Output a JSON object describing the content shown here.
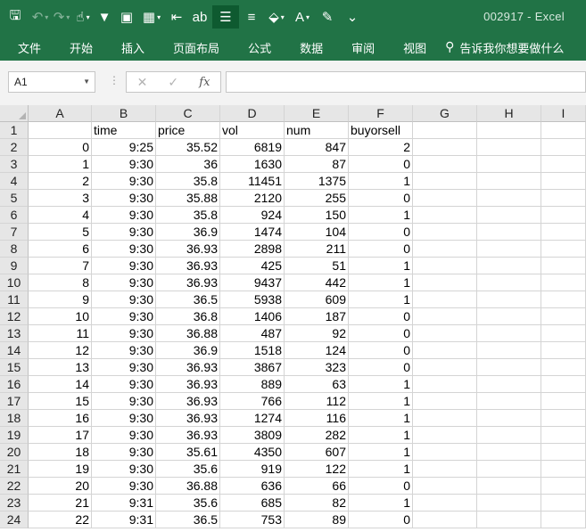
{
  "window": {
    "title": "002917  -  Excel"
  },
  "qat": [
    {
      "name": "save-icon",
      "glyph": "🖫",
      "dim": false,
      "caret": false
    },
    {
      "name": "undo-icon",
      "glyph": "↶",
      "dim": true,
      "caret": true
    },
    {
      "name": "redo-icon",
      "glyph": "↷",
      "dim": true,
      "caret": true
    },
    {
      "name": "touch-mode-icon",
      "glyph": "☝",
      "dim": false,
      "caret": true
    },
    {
      "name": "filter-icon",
      "glyph": "▼",
      "dim": false,
      "caret": false
    },
    {
      "name": "form-icon",
      "glyph": "▣",
      "dim": false,
      "caret": false
    },
    {
      "name": "table-format-icon",
      "glyph": "▦",
      "dim": false,
      "caret": true
    },
    {
      "name": "indent-icon",
      "glyph": "⇤",
      "dim": false,
      "caret": false
    },
    {
      "name": "wrap-text-icon",
      "glyph": "ab",
      "dim": false,
      "caret": false
    },
    {
      "name": "align-middle-icon",
      "glyph": "☰",
      "dim": false,
      "caret": false,
      "active": true
    },
    {
      "name": "align-center-icon",
      "glyph": "≡",
      "dim": false,
      "caret": false
    },
    {
      "name": "fill-color-icon",
      "glyph": "⬙",
      "dim": false,
      "caret": true
    },
    {
      "name": "font-color-icon",
      "glyph": "A",
      "dim": false,
      "caret": true
    },
    {
      "name": "format-painter-icon",
      "glyph": "✎",
      "dim": false,
      "caret": false
    },
    {
      "name": "customize-qat-icon",
      "glyph": "⌄",
      "dim": false,
      "caret": false
    }
  ],
  "menu": [
    "文件",
    "开始",
    "插入",
    "页面布局",
    "公式",
    "数据",
    "审阅",
    "视图"
  ],
  "tell_me": "告诉我你想要做什么",
  "formula_bar": {
    "name_box": "A1",
    "formula": ""
  },
  "columns": [
    "A",
    "B",
    "C",
    "D",
    "E",
    "F",
    "G",
    "H",
    "I"
  ],
  "header_row": [
    "",
    "time",
    "price",
    "vol",
    "num",
    "buyorsell"
  ],
  "rows": [
    [
      "0",
      "9:25",
      "35.52",
      "6819",
      "847",
      "2"
    ],
    [
      "1",
      "9:30",
      "36",
      "1630",
      "87",
      "0"
    ],
    [
      "2",
      "9:30",
      "35.8",
      "11451",
      "1375",
      "1"
    ],
    [
      "3",
      "9:30",
      "35.88",
      "2120",
      "255",
      "0"
    ],
    [
      "4",
      "9:30",
      "35.8",
      "924",
      "150",
      "1"
    ],
    [
      "5",
      "9:30",
      "36.9",
      "1474",
      "104",
      "0"
    ],
    [
      "6",
      "9:30",
      "36.93",
      "2898",
      "211",
      "0"
    ],
    [
      "7",
      "9:30",
      "36.93",
      "425",
      "51",
      "1"
    ],
    [
      "8",
      "9:30",
      "36.93",
      "9437",
      "442",
      "1"
    ],
    [
      "9",
      "9:30",
      "36.5",
      "5938",
      "609",
      "1"
    ],
    [
      "10",
      "9:30",
      "36.8",
      "1406",
      "187",
      "0"
    ],
    [
      "11",
      "9:30",
      "36.88",
      "487",
      "92",
      "0"
    ],
    [
      "12",
      "9:30",
      "36.9",
      "1518",
      "124",
      "0"
    ],
    [
      "13",
      "9:30",
      "36.93",
      "3867",
      "323",
      "0"
    ],
    [
      "14",
      "9:30",
      "36.93",
      "889",
      "63",
      "1"
    ],
    [
      "15",
      "9:30",
      "36.93",
      "766",
      "112",
      "1"
    ],
    [
      "16",
      "9:30",
      "36.93",
      "1274",
      "116",
      "1"
    ],
    [
      "17",
      "9:30",
      "36.93",
      "3809",
      "282",
      "1"
    ],
    [
      "18",
      "9:30",
      "35.61",
      "4350",
      "607",
      "1"
    ],
    [
      "19",
      "9:30",
      "35.6",
      "919",
      "122",
      "1"
    ],
    [
      "20",
      "9:30",
      "36.88",
      "636",
      "66",
      "0"
    ],
    [
      "21",
      "9:31",
      "35.6",
      "685",
      "82",
      "1"
    ],
    [
      "22",
      "9:31",
      "36.5",
      "753",
      "89",
      "0"
    ]
  ],
  "colors": {
    "brand": "#217346",
    "grid_line": "#d4d4d4",
    "header_bg": "#e6e6e6"
  }
}
